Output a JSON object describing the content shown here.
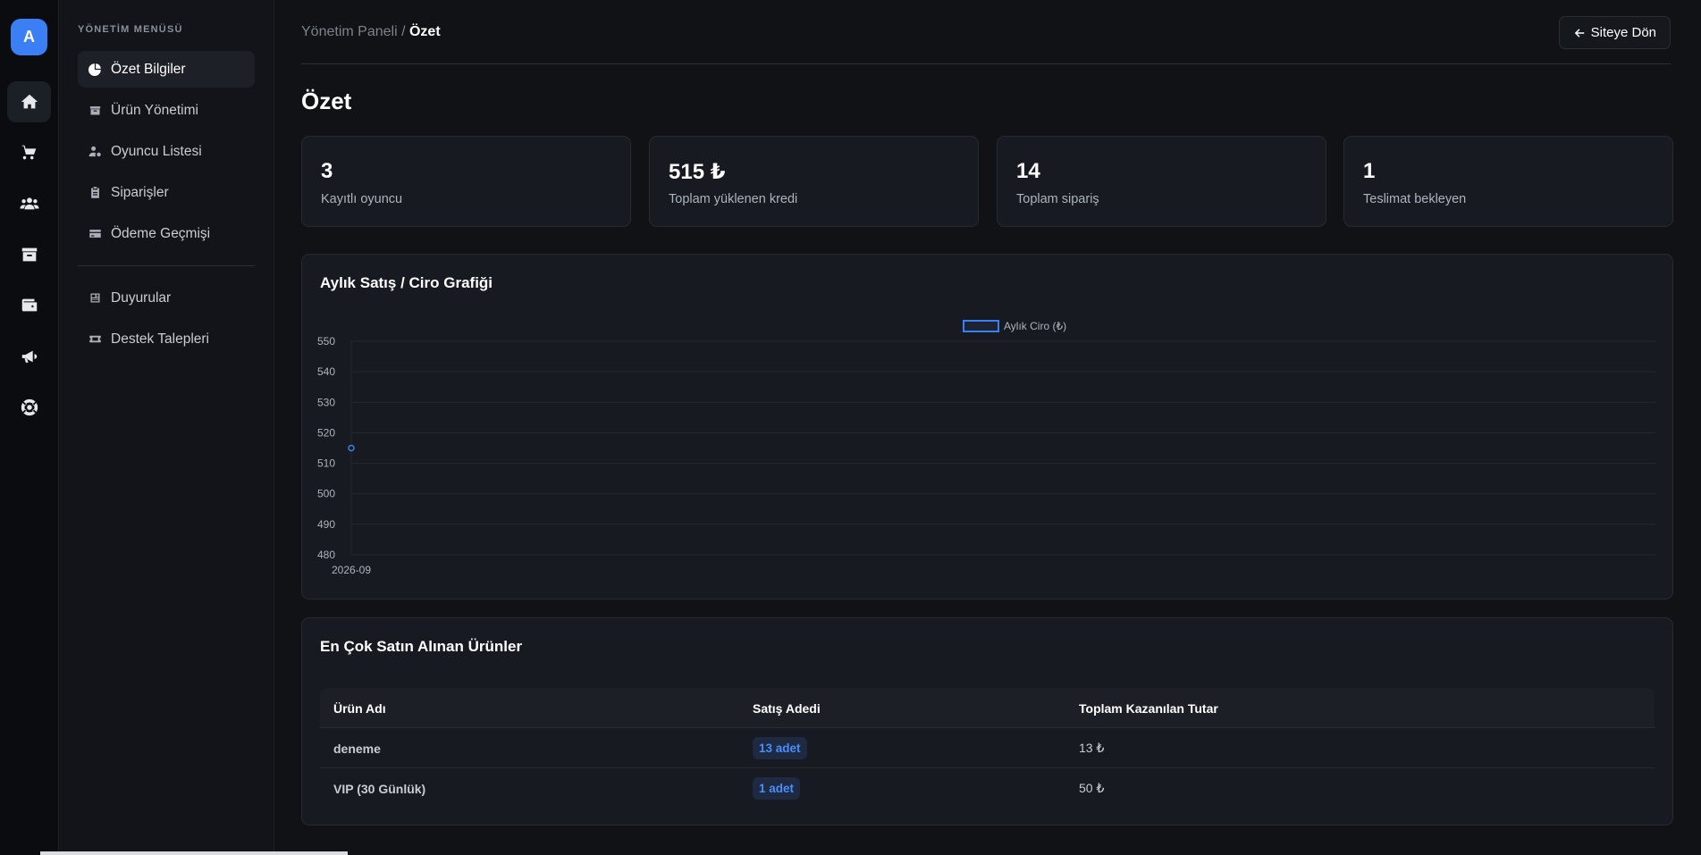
{
  "rail": {
    "logo_letter": "A",
    "icons": [
      "home-icon",
      "cart-icon",
      "users-icon",
      "archive-icon",
      "wallet-icon",
      "megaphone-icon",
      "lifebuoy-icon"
    ]
  },
  "sidebar": {
    "title": "YÖNETİM MENÜSÜ",
    "items": [
      {
        "label": "Özet Bilgiler",
        "icon": "pie-chart-icon"
      },
      {
        "label": "Ürün Yönetimi",
        "icon": "box-icon"
      },
      {
        "label": "Oyuncu Listesi",
        "icon": "user-gear-icon"
      },
      {
        "label": "Siparişler",
        "icon": "clipboard-icon"
      },
      {
        "label": "Ödeme Geçmişi",
        "icon": "credit-card-icon"
      },
      {
        "label": "Duyurular",
        "icon": "newspaper-icon"
      },
      {
        "label": "Destek Talepleri",
        "icon": "ticket-icon"
      }
    ]
  },
  "header": {
    "breadcrumb_root": "Yönetim Paneli",
    "breadcrumb_sep": "/",
    "breadcrumb_current": "Özet",
    "back_label": "Siteye Dön"
  },
  "page": {
    "title": "Özet"
  },
  "stats": [
    {
      "value": "3",
      "label": "Kayıtlı oyuncu"
    },
    {
      "value": "515 ₺",
      "label": "Toplam yüklenen kredi"
    },
    {
      "value": "14",
      "label": "Toplam sipariş"
    },
    {
      "value": "1",
      "label": "Teslimat bekleyen"
    }
  ],
  "chart_card": {
    "title": "Aylık Satış / Ciro Grafiği"
  },
  "chart_data": {
    "type": "line",
    "title": "Aylık Satış / Ciro Grafiği",
    "categories": [
      "2026-09"
    ],
    "series": [
      {
        "name": "Aylık Ciro (₺)",
        "values": [
          515
        ],
        "color": "#3b7ff5"
      }
    ],
    "ylim": [
      480,
      550
    ],
    "yticks": [
      550,
      540,
      530,
      520,
      510,
      500,
      490,
      480
    ],
    "grid": true,
    "legend": "top-center"
  },
  "products_card": {
    "title": "En Çok Satın Alınan Ürünler",
    "columns": [
      "Ürün Adı",
      "Satış Adedi",
      "Toplam Kazanılan Tutar"
    ],
    "rows": [
      {
        "name": "deneme",
        "qty": "13 adet",
        "total": "13 ₺"
      },
      {
        "name": "VIP (30 Günlük)",
        "qty": "1 adet",
        "total": "50 ₺"
      }
    ]
  }
}
